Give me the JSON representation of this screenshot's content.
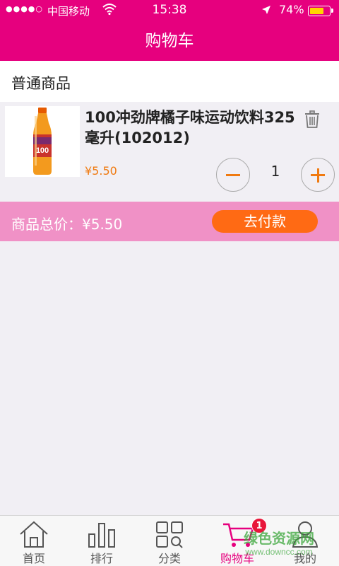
{
  "status_bar": {
    "signal": "●●●●○",
    "carrier": "中国移动",
    "time": "15:38",
    "battery_percent": "74%",
    "battery_level": 0.74
  },
  "nav": {
    "title": "购物车"
  },
  "section": {
    "title": "普通商品"
  },
  "item": {
    "name": "100冲劲牌橘子味运动饮料325毫升(102012)",
    "price": "¥5.50",
    "quantity": "1",
    "bottle_label": "100"
  },
  "total": {
    "label": "商品总价：¥5.50",
    "pay_button": "去付款"
  },
  "tabs": [
    {
      "label": "首页",
      "icon": "home-icon"
    },
    {
      "label": "排行",
      "icon": "ranking-icon"
    },
    {
      "label": "分类",
      "icon": "category-icon"
    },
    {
      "label": "购物车",
      "icon": "cart-icon",
      "active": true,
      "badge": "1"
    },
    {
      "label": "我的",
      "icon": "profile-icon"
    }
  ],
  "watermark": {
    "line1": "绿色资源网",
    "line2": "www.downcc.com"
  },
  "colors": {
    "brand": "#e6007e",
    "accent_orange": "#ff6a14",
    "price_orange": "#f07a10",
    "total_bar": "#f091c6",
    "background": "#f1eff4"
  }
}
